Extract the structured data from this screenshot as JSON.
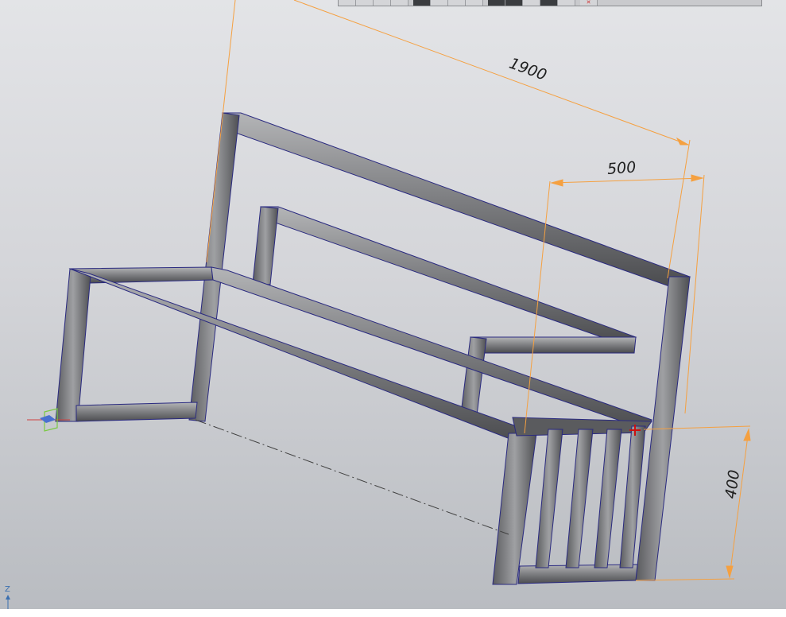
{
  "dimensions": {
    "d1": "1900",
    "d2": "500",
    "d3": "400"
  },
  "axis": {
    "z": "Z"
  },
  "toolbar": {
    "buttons": [
      {
        "icon": "toolbar-icon",
        "state": "normal"
      },
      {
        "icon": "toolbar-icon",
        "state": "normal"
      },
      {
        "icon": "toolbar-icon",
        "state": "normal"
      },
      {
        "icon": "toolbar-icon",
        "state": "normal"
      },
      {
        "icon": "toolbar-icon",
        "state": "active"
      },
      {
        "icon": "toolbar-icon",
        "state": "normal"
      },
      {
        "icon": "toolbar-icon",
        "state": "normal"
      },
      {
        "icon": "toolbar-icon",
        "state": "normal"
      },
      {
        "icon": "toolbar-icon",
        "state": "active"
      },
      {
        "icon": "toolbar-icon",
        "state": "active"
      },
      {
        "icon": "toolbar-icon",
        "state": "normal"
      },
      {
        "icon": "toolbar-icon",
        "state": "active"
      },
      {
        "icon": "toolbar-icon",
        "state": "normal"
      },
      {
        "icon": "close-icon",
        "state": "normal"
      }
    ]
  },
  "colors": {
    "dimension": "#f5a040",
    "edge": "#2a2a80",
    "beam_face": "#a9aaac",
    "beam_dark": "#4a4b4e",
    "origin": "#7ac943"
  }
}
